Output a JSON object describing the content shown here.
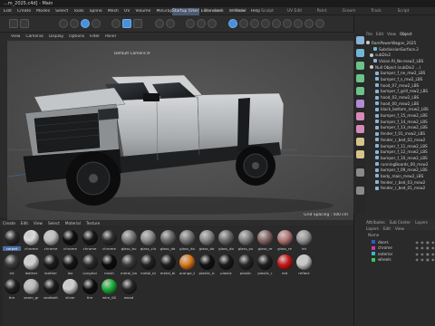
{
  "window": {
    "title": "...m_2025.c4d] - Main"
  },
  "menubar": {
    "items": [
      "Edit",
      "Create",
      "Modes",
      "Select",
      "Tools",
      "Spline",
      "Mesh",
      "UV",
      "Volume",
      "MoGraph",
      "Render",
      "Extensions",
      "Window",
      "Help"
    ]
  },
  "layouts": {
    "items": [
      "Startup (User)",
      "Standard",
      "Model",
      "Sculpt",
      "UV Edit",
      "Paint",
      "Groom",
      "Track",
      "Script"
    ],
    "active_index": 0
  },
  "viewport": {
    "menu": [
      "View",
      "Cameras",
      "Display",
      "Options",
      "Filter",
      "Panel"
    ],
    "camera_label": "Default Camera ⟳",
    "grid_label": "Grid Spacing : 500 cm"
  },
  "objects": {
    "tabs": [
      "File",
      "Edit",
      "View",
      "Object"
    ],
    "active_tab": "Object",
    "items": [
      {
        "name": "RamPowerWagon_2025",
        "type": "null"
      },
      {
        "name": "SubdivisionSurface.2",
        "type": "tri"
      },
      {
        "name": "subDiv2",
        "type": "null"
      },
      {
        "name": "Vision Rl_Ne.msw2_LBS",
        "type": "mesh"
      },
      {
        "name": "Null Object (subDiv2 ...)",
        "type": "null"
      },
      {
        "name": "bumper_f_ne_mw2_LBS",
        "type": "mesh"
      },
      {
        "name": "bumper_f_s_mw2_LBS",
        "type": "mesh"
      },
      {
        "name": "hood_07_msw2_LBS",
        "type": "mesh"
      },
      {
        "name": "bumper_f_grill_mw2_LBS",
        "type": "mesh"
      },
      {
        "name": "hood_02_msw2_LBS",
        "type": "mesh"
      },
      {
        "name": "hood_00_msw2_LBS",
        "type": "mesh"
      },
      {
        "name": "black_bottom_msw2_LBS",
        "type": "mesh"
      },
      {
        "name": "bumper_f_15_msw2_LBS",
        "type": "mesh"
      },
      {
        "name": "bumper_f_14_msw2_LBS",
        "type": "mesh"
      },
      {
        "name": "bumper_f_13_msw2_LBS",
        "type": "mesh"
      },
      {
        "name": "fender_f_01_msw2_LBS",
        "type": "mesh"
      },
      {
        "name": "fender_r_bed_02_msw2",
        "type": "mesh"
      },
      {
        "name": "bumper_f_11_msw2_LBS",
        "type": "mesh"
      },
      {
        "name": "bumper_f_12_msw2_LBS",
        "type": "mesh"
      },
      {
        "name": "bumper_f_10_msw2_LBS",
        "type": "mesh"
      },
      {
        "name": "runningBoards_00_msw2",
        "type": "mesh"
      },
      {
        "name": "bumper_f_09_msw2_LBS",
        "type": "mesh"
      },
      {
        "name": "body_main_msw2_LBS",
        "type": "mesh"
      },
      {
        "name": "fender_r_bed_03_msw2",
        "type": "mesh"
      },
      {
        "name": "fender_r_bed_01_msw2",
        "type": "mesh"
      }
    ]
  },
  "attributes": {
    "tabs": [
      "Attributes",
      "Sub Center",
      "Layers"
    ]
  },
  "layers_panel": {
    "tabs": [
      "Layers",
      "Edit",
      "View"
    ],
    "header": "Name",
    "items": [
      {
        "name": "doors",
        "color": "#3a56c8"
      },
      {
        "name": "chrome",
        "color": "#c83aa8"
      },
      {
        "name": "exterior",
        "color": "#3ab7c8"
      },
      {
        "name": "wheels",
        "color": "#3ac85a"
      }
    ]
  },
  "material_manager": {
    "menu": [
      "Create",
      "Edit",
      "View",
      "Select",
      "Material",
      "Texture"
    ],
    "rows": [
      [
        {
          "label": "carpet",
          "color": "#2a2a2a"
        },
        {
          "label": "chrome",
          "color": "#d9d9d9"
        },
        {
          "label": "chrome",
          "color": "#bfbfbf"
        },
        {
          "label": "chrome",
          "color": "#101010"
        },
        {
          "label": "chrome",
          "color": "#181818"
        },
        {
          "label": "chrome",
          "color": "#2f2f2f"
        },
        {
          "label": "glass_bu",
          "color": "#7c7c7c"
        },
        {
          "label": "glass_clu",
          "color": "#8f8f8f"
        },
        {
          "label": "glass_da",
          "color": "#6d6d6d"
        },
        {
          "label": "glass_do",
          "color": "#7a7a7a"
        },
        {
          "label": "glass_do",
          "color": "#898989"
        },
        {
          "label": "glass_do",
          "color": "#707070"
        },
        {
          "label": "glass_ou",
          "color": "#828282"
        },
        {
          "label": "glass_re",
          "color": "#8a6a6a"
        },
        {
          "label": "glass_re",
          "color": "#b87878"
        },
        {
          "label": "int",
          "color": "#9a9a9a"
        }
      ],
      [
        {
          "label": "int",
          "color": "#3c3c3c"
        },
        {
          "label": "leather",
          "color": "#d0d0d0"
        },
        {
          "label": "leather",
          "color": "#1c1c1c"
        },
        {
          "label": "leo",
          "color": "#151515"
        },
        {
          "label": "Longhai",
          "color": "#2a2a2a"
        },
        {
          "label": "mesh",
          "color": "#0c0c0c"
        },
        {
          "label": "metal_ba",
          "color": "#3a3a3a"
        },
        {
          "label": "metal_bi",
          "color": "#222222"
        },
        {
          "label": "metal_bl",
          "color": "#1e1e1e"
        },
        {
          "label": "orange_t",
          "color": "#e07a1a"
        },
        {
          "label": "plastic_b",
          "color": "#121212"
        },
        {
          "label": "plastic",
          "color": "#1a1a1a"
        },
        {
          "label": "plastic",
          "color": "#262626"
        },
        {
          "label": "plastic_r",
          "color": "#202020"
        },
        {
          "label": "red",
          "color": "#d01818"
        },
        {
          "label": "reflect",
          "color": "#c8c8c8"
        }
      ],
      [
        {
          "label": "tire",
          "color": "#202020"
        },
        {
          "label": "seam_gr",
          "color": "#b8b8b8"
        },
        {
          "label": "seatbelt",
          "color": "#1c1c1c"
        },
        {
          "label": "silver",
          "color": "#cfcfcf"
        },
        {
          "label": "tire",
          "color": "#0f0f0f"
        },
        {
          "label": "wire_00",
          "color": "#1fb03a"
        },
        {
          "label": "wood",
          "color": "#262626"
        }
      ]
    ],
    "selected": {
      "row": 0,
      "col": 0
    }
  },
  "colors": {
    "accent": "#4a90d9",
    "active_layout": "#4c5a72",
    "truck_body": "#b9bcbf",
    "viewport_bg": "#4f4f4f"
  }
}
